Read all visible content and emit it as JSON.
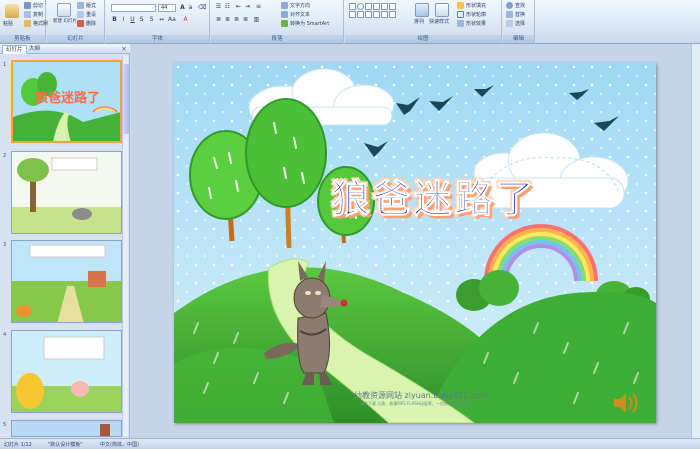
{
  "ribbon": {
    "clipboard": {
      "label": "剪贴板",
      "paste": "粘贴",
      "cut": "剪切",
      "copy": "复制",
      "format": "格式刷"
    },
    "slides": {
      "label": "幻灯片",
      "new": "新建\n幻灯片",
      "layout": "版式",
      "reset": "重设",
      "delete": "删除"
    },
    "font": {
      "label": "字体",
      "size": "44"
    },
    "paragraph": {
      "label": "段落",
      "direction": "文字方向",
      "align": "对齐文本",
      "smartart": "转换为 SmartArt"
    },
    "drawing": {
      "label": "绘图",
      "arrange": "排列",
      "quickstyles": "快速样式",
      "fill": "形状填充",
      "outline": "形状轮廓",
      "effects": "形状效果"
    },
    "editing": {
      "label": "编辑",
      "find": "查找",
      "replace": "替换",
      "select": "选择"
    }
  },
  "panel": {
    "tab_slides": "幻灯片",
    "tab_outline": "大纲",
    "close": "×",
    "thumbs": [
      {
        "num": "1"
      },
      {
        "num": "2"
      },
      {
        "num": "3"
      },
      {
        "num": "4"
      },
      {
        "num": "5"
      }
    ]
  },
  "slide": {
    "title": "狼爸迷路了",
    "site": "幼教资源网站  ziyuan.baby611.com",
    "site_sub": "课件下载   儿歌、故事MP3   FLASH动画等，一应俱全的幼教资源"
  },
  "status": {
    "slide_count": "幻灯片 1/12",
    "theme": "\"默认设计模板\"",
    "language": "中文(简体，中国)"
  },
  "colors": {
    "sky": "#aee0f6",
    "grass": "#43b236",
    "grass_dark": "#2e8f2a",
    "tree": "#55c83c",
    "title": "#1c1fa6",
    "title_glow": "#ff9f74",
    "selection": "#f2a33a"
  }
}
